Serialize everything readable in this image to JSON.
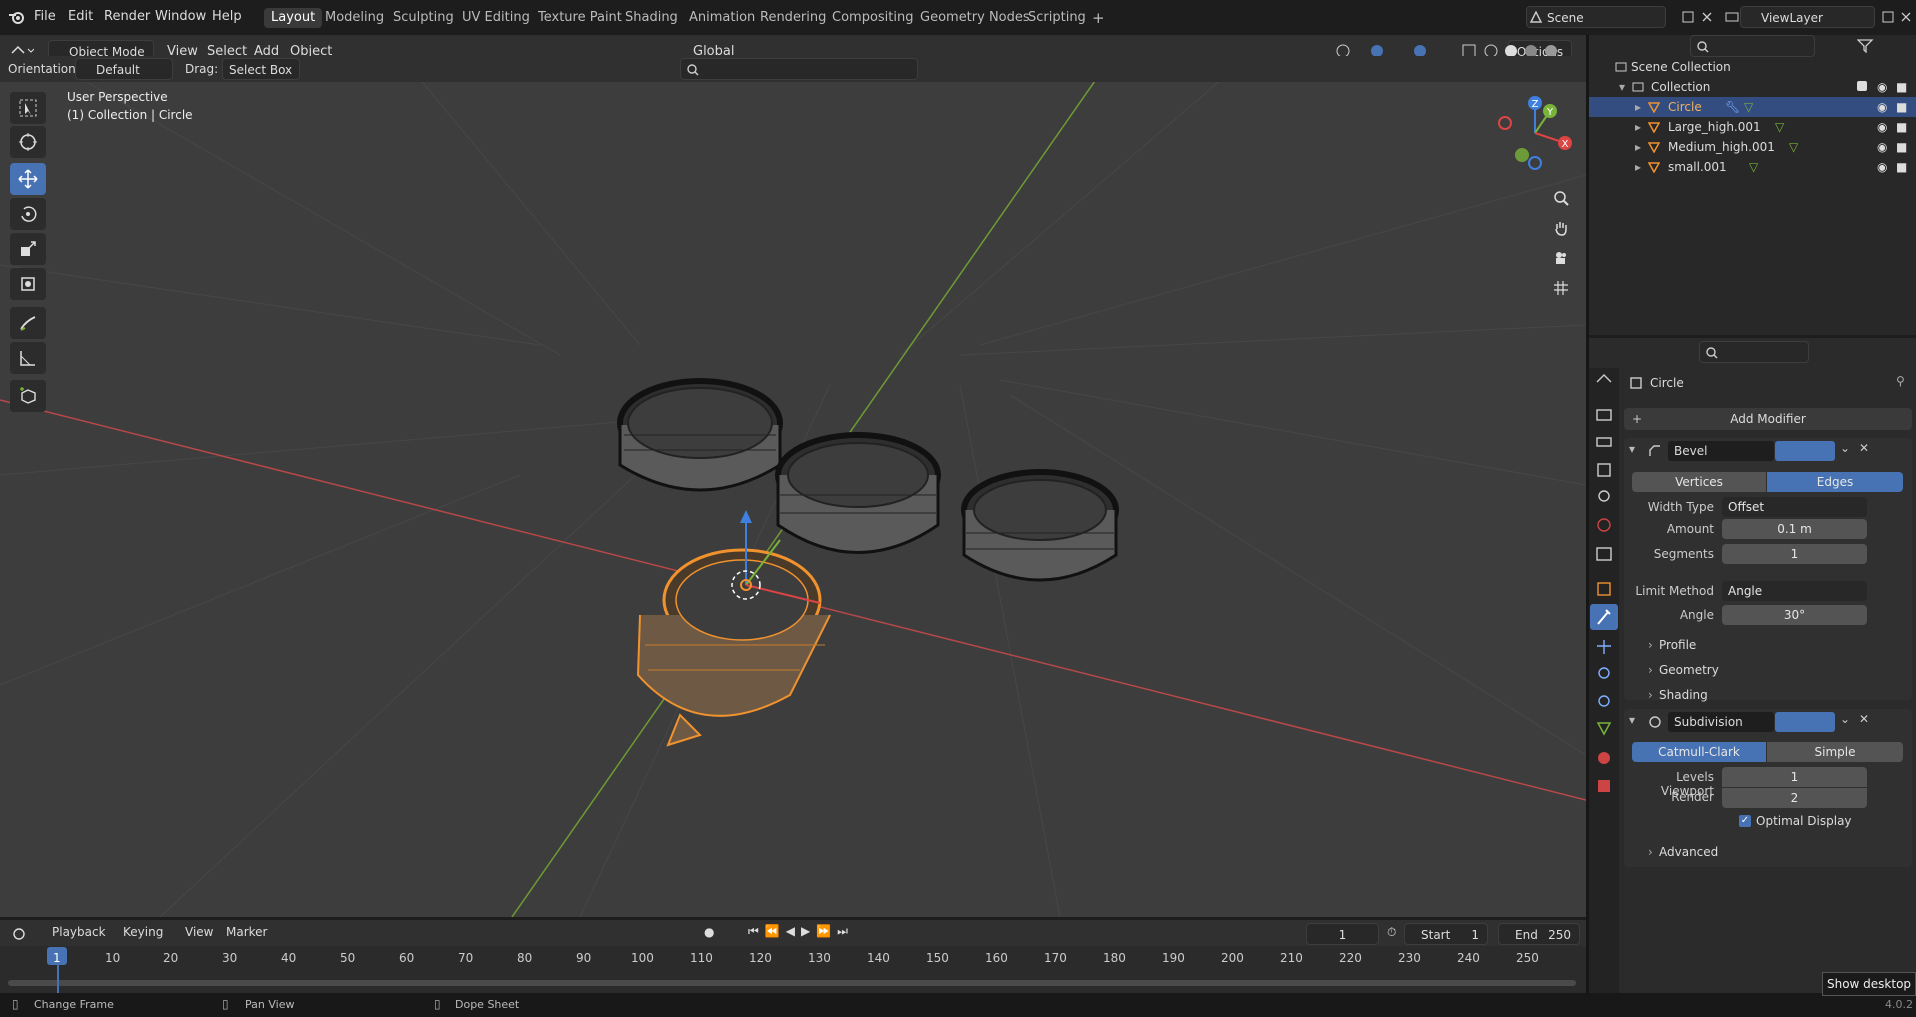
{
  "topbar": {
    "menus": [
      "File",
      "Edit",
      "Render",
      "Window",
      "Help"
    ],
    "workspaces": [
      "Layout",
      "Modeling",
      "Sculpting",
      "UV Editing",
      "Texture Paint",
      "Shading",
      "Animation",
      "Rendering",
      "Compositing",
      "Geometry Nodes",
      "Scripting"
    ],
    "active_workspace": "Layout",
    "add_tab": "+",
    "scene": "Scene",
    "view_layer": "ViewLayer"
  },
  "viewport_header": {
    "mode": "Object Mode",
    "menus": [
      "View",
      "Select",
      "Add",
      "Object"
    ],
    "orientation_label": "Orientation:",
    "orientation_value": "Default",
    "drag_label": "Drag:",
    "drag_value": "Select Box",
    "transform_orientation": "Global",
    "options": "Options"
  },
  "viewport": {
    "perspective": "User Perspective",
    "collection_info": "(1) Collection | Circle",
    "gizmo": {
      "x": "X",
      "y": "Y",
      "z": "Z"
    }
  },
  "outliner": {
    "scene_collection": "Scene Collection",
    "collection": "Collection",
    "objects": [
      "Circle",
      "Large_high.001",
      "Medium_high.001",
      "small.001"
    ],
    "selected": "Circle"
  },
  "properties": {
    "object_name": "Circle",
    "add_modifier": "Add Modifier",
    "bevel": {
      "name": "Bevel",
      "mode_options": [
        "Vertices",
        "Edges"
      ],
      "mode_selected": "Edges",
      "width_type_label": "Width Type",
      "width_type": "Offset",
      "amount_label": "Amount",
      "amount": "0.1 m",
      "segments_label": "Segments",
      "segments": "1",
      "limit_method_label": "Limit Method",
      "limit_method": "Angle",
      "angle_label": "Angle",
      "angle": "30°",
      "subpanels": [
        "Profile",
        "Geometry",
        "Shading"
      ]
    },
    "subdivision": {
      "name": "Subdivision",
      "type_options": [
        "Catmull-Clark",
        "Simple"
      ],
      "type_selected": "Catmull-Clark",
      "levels_viewport_label": "Levels Viewport",
      "levels_viewport": "1",
      "render_label": "Render",
      "render": "2",
      "optimal_display": "Optimal Display",
      "advanced": "Advanced"
    }
  },
  "timeline": {
    "menus": [
      "Playback",
      "Keying",
      "View",
      "Marker"
    ],
    "current_frame": "1",
    "start_label": "Start",
    "start": "1",
    "end_label": "End",
    "end": "250",
    "ticks": [
      "1",
      "10",
      "20",
      "30",
      "40",
      "50",
      "60",
      "70",
      "80",
      "90",
      "100",
      "110",
      "120",
      "130",
      "140",
      "150",
      "160",
      "170",
      "180",
      "190",
      "200",
      "210",
      "220",
      "230",
      "240",
      "250"
    ]
  },
  "statusbar": {
    "hints": [
      "Change Frame",
      "Pan View",
      "Dope Sheet"
    ],
    "show_desktop": "Show desktop",
    "version": "4.0.2"
  },
  "colors": {
    "accent": "#4772b3",
    "selected_orange": "#f0922e",
    "x_axis": "#c94a4a",
    "y_axis": "#7aa33a"
  }
}
